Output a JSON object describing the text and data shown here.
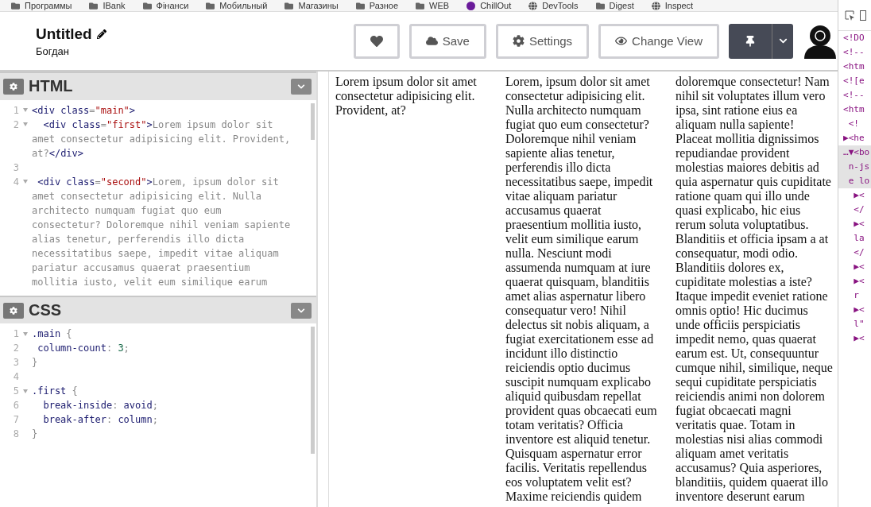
{
  "bookmarks": [
    {
      "label": "Программы",
      "kind": "folder"
    },
    {
      "label": "IBank",
      "kind": "folder"
    },
    {
      "label": "Фінанси",
      "kind": "folder"
    },
    {
      "label": "Мобильный",
      "kind": "folder"
    },
    {
      "label": "Магазины",
      "kind": "folder"
    },
    {
      "label": "Разное",
      "kind": "folder"
    },
    {
      "label": "WEB",
      "kind": "folder"
    },
    {
      "label": "ChillOut",
      "kind": "badge"
    },
    {
      "label": "DevTools",
      "kind": "site"
    },
    {
      "label": "Digest",
      "kind": "folder"
    },
    {
      "label": "Inspect",
      "kind": "site"
    }
  ],
  "header": {
    "title": "Untitled",
    "author": "Богдан",
    "buttons": [
      {
        "kind": "heart"
      },
      {
        "kind": "cloud",
        "label": "Save"
      },
      {
        "kind": "gear",
        "label": "Settings"
      },
      {
        "kind": "view",
        "label": "Change View"
      }
    ]
  },
  "editors": [
    {
      "title": "HTML",
      "lines": [
        {
          "number": "1",
          "foldable": true,
          "tokens": [
            {
              "kind": "tag",
              "s": "<div "
            },
            {
              "kind": "attr",
              "s": "class"
            },
            {
              "kind": "punct",
              "s": "="
            },
            {
              "kind": "string",
              "s": "\"main\""
            },
            {
              "kind": "tag",
              "s": ">"
            }
          ]
        },
        {
          "number": "2",
          "foldable": true,
          "tokens": [
            {
              "kind": "tag",
              "s": "  <div "
            },
            {
              "kind": "attr",
              "s": "class"
            },
            {
              "kind": "punct",
              "s": "="
            },
            {
              "kind": "string",
              "s": "\"first\""
            },
            {
              "kind": "tag",
              "s": ">"
            },
            {
              "kind": "text",
              "s": "Lorem ipsum dolor sit"
            }
          ]
        },
        {
          "tokens": [
            {
              "kind": "text",
              "s": "amet consectetur adipisicing elit. Provident,"
            }
          ]
        },
        {
          "tokens": [
            {
              "kind": "text",
              "s": "at?"
            },
            {
              "kind": "tag",
              "s": "</div>"
            }
          ]
        },
        {
          "number": "3",
          "foldable": false
        },
        {
          "number": "4",
          "foldable": true,
          "tokens": [
            {
              "kind": "tag",
              "s": " <div "
            },
            {
              "kind": "attr",
              "s": "class"
            },
            {
              "kind": "punct",
              "s": "="
            },
            {
              "kind": "string",
              "s": "\"second\""
            },
            {
              "kind": "tag",
              "s": ">"
            },
            {
              "kind": "text",
              "s": "Lorem, ipsum dolor sit"
            }
          ]
        },
        {
          "tokens": [
            {
              "kind": "text",
              "s": "amet consectetur adipisicing elit. Nulla"
            }
          ]
        },
        {
          "tokens": [
            {
              "kind": "text",
              "s": "architecto numquam fugiat quo eum"
            }
          ]
        },
        {
          "tokens": [
            {
              "kind": "text",
              "s": "consectetur? Doloremque nihil veniam sapiente"
            }
          ]
        },
        {
          "tokens": [
            {
              "kind": "text",
              "s": "alias tenetur, perferendis illo dicta"
            }
          ]
        },
        {
          "tokens": [
            {
              "kind": "text",
              "s": "necessitatibus saepe, impedit vitae aliquam"
            }
          ]
        },
        {
          "tokens": [
            {
              "kind": "text",
              "s": "pariatur accusamus quaerat praesentium"
            }
          ]
        },
        {
          "tokens": [
            {
              "kind": "text",
              "s": "mollitia iusto, velit eum similique earum"
            }
          ]
        }
      ]
    },
    {
      "title": "CSS",
      "lines": [
        {
          "number": "1",
          "foldable": true,
          "tokens": [
            {
              "kind": "attr",
              "s": ".main "
            },
            {
              "kind": "punct",
              "s": "{"
            }
          ]
        },
        {
          "number": "2",
          "foldable": false,
          "tokens": [
            {
              "kind": "attr",
              "s": " column-count"
            },
            {
              "kind": "punct",
              "s": ": "
            },
            {
              "kind": "number",
              "s": "3"
            },
            {
              "kind": "punct",
              "s": ";"
            }
          ]
        },
        {
          "number": "3",
          "foldable": false,
          "tokens": [
            {
              "kind": "punct",
              "s": "}"
            }
          ]
        },
        {
          "number": "4",
          "foldable": false
        },
        {
          "number": "5",
          "foldable": true,
          "tokens": [
            {
              "kind": "attr",
              "s": ".first "
            },
            {
              "kind": "punct",
              "s": "{"
            }
          ]
        },
        {
          "number": "6",
          "foldable": false,
          "tokens": [
            {
              "kind": "attr",
              "s": "  break-inside"
            },
            {
              "kind": "punct",
              "s": ": "
            },
            {
              "kind": "attr",
              "s": "avoid"
            },
            {
              "kind": "punct",
              "s": ";"
            }
          ]
        },
        {
          "number": "7",
          "foldable": false,
          "tokens": [
            {
              "kind": "attr",
              "s": "  break-after"
            },
            {
              "kind": "punct",
              "s": ": "
            },
            {
              "kind": "attr",
              "s": "column"
            },
            {
              "kind": "punct",
              "s": ";"
            }
          ]
        },
        {
          "number": "8",
          "foldable": false,
          "tokens": [
            {
              "kind": "punct",
              "s": "}"
            }
          ]
        }
      ]
    }
  ],
  "preview": {
    "columns": [
      [
        "Lorem ipsum dolor sit amet",
        "consectetur adipisicing elit.",
        "Provident, at?"
      ],
      [
        "Lorem, ipsum dolor sit amet",
        "consectetur adipisicing elit.",
        "Nulla architecto numquam",
        "fugiat quo eum consectetur?",
        "Doloremque nihil veniam",
        "sapiente alias tenetur,",
        "perferendis illo dicta",
        "necessitatibus saepe, impedit",
        "vitae aliquam pariatur",
        "accusamus quaerat",
        "praesentium mollitia iusto,",
        "velit eum similique earum",
        "nulla. Nesciunt modi",
        "assumenda numquam at iure",
        "quaerat quisquam, blanditiis",
        "amet alias aspernatur libero",
        "consequatur vero! Nihil",
        "delectus sit nobis aliquam, a",
        "fugiat exercitationem esse ad",
        "incidunt illo distinctio",
        "reiciendis optio ducimus",
        "suscipit numquam explicabo",
        "aliquid quibusdam repellat",
        "provident quas obcaecati eum",
        "totam veritatis? Officia",
        "inventore est aliquid tenetur.",
        "Quisquam aspernatur error",
        "facilis. Veritatis repellendus",
        "eos voluptatem velit est?",
        "Maxime reiciendis quidem"
      ],
      [
        "doloremque consectetur! Nam",
        "nihil sit voluptates illum vero",
        "ipsa, sint ratione eius ea",
        "aliquam nulla sapiente!",
        "Placeat mollitia dignissimos",
        "repudiandae provident",
        "molestias maiores debitis ad",
        "quia aspernatur quis cupiditate",
        "ratione quam qui illo unde",
        "quasi explicabo, hic eius",
        "rerum soluta voluptatibus.",
        "Blanditiis et officia ipsam a at",
        "consequatur, modi odio.",
        "Blanditiis dolores ex,",
        "cupiditate molestias a iste?",
        "Itaque impedit eveniet ratione",
        "omnis optio! Hic ducimus",
        "unde officiis perspiciatis",
        "impedit nemo, quas quaerat",
        "earum est. Ut, consequuntur",
        "cumque nihil, similique, neque",
        "sequi cupiditate perspiciatis",
        "reiciendis animi non dolorem",
        "fugiat obcaecati magni",
        "veritatis quae. Totam in",
        "molestias nisi alias commodi",
        "aliquam amet veritatis",
        "accusamus? Quia asperiores,",
        "blanditiis, quidem quaerat illo",
        "inventore deserunt earum"
      ]
    ]
  },
  "devtools": {
    "lines": [
      {
        "text": "<!DO",
        "selected": false
      },
      {
        "text": "<!--",
        "selected": false
      },
      {
        "text": "<htm",
        "selected": false
      },
      {
        "text": "<![e",
        "selected": false
      },
      {
        "text": "<!--",
        "selected": false
      },
      {
        "text": "<htm",
        "selected": false
      },
      {
        "text": " <!",
        "selected": false
      },
      {
        "text": "▶<he",
        "selected": false
      },
      {
        "text": "…▼<bo",
        "selected": true
      },
      {
        "text": " n-js",
        "selected": true
      },
      {
        "text": " e lo",
        "selected": true
      },
      {
        "text": "  ▶<",
        "selected": false
      },
      {
        "text": "  </",
        "selected": false
      },
      {
        "text": "  ▶<",
        "selected": false
      },
      {
        "text": "  la",
        "selected": false
      },
      {
        "text": "  </",
        "selected": false
      },
      {
        "text": "  ▶<",
        "selected": false
      },
      {
        "text": "  ▶<",
        "selected": false
      },
      {
        "text": "  r",
        "selected": false
      },
      {
        "text": "  ▶<",
        "selected": false
      },
      {
        "text": "  l\"",
        "selected": false
      },
      {
        "text": "  ▶<",
        "selected": false
      }
    ]
  }
}
